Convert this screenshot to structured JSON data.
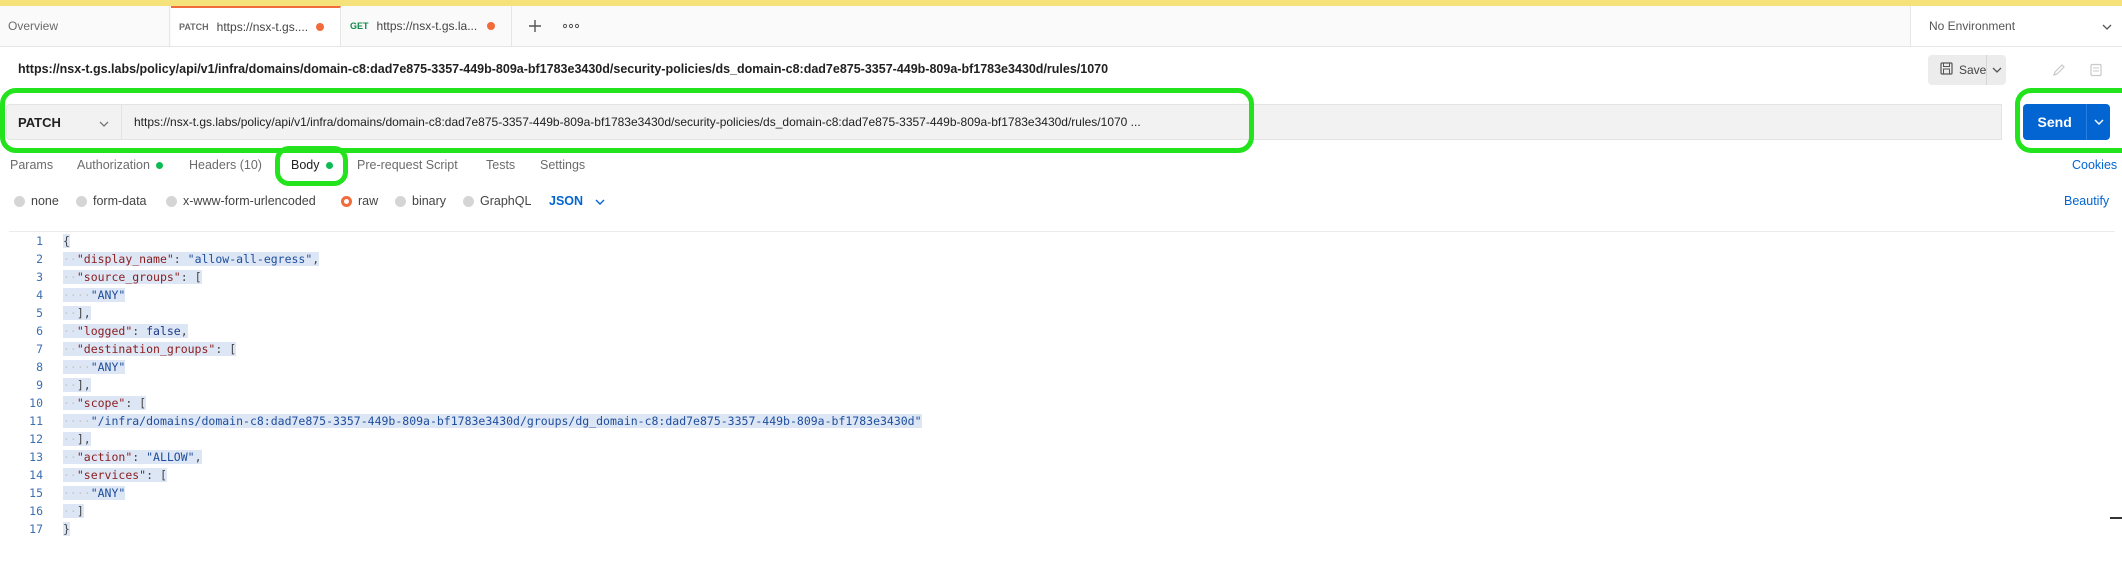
{
  "tabs": {
    "overview": "Overview",
    "items": [
      {
        "method": "PATCH",
        "title": "https://nsx-t.gs...."
      },
      {
        "method": "GET",
        "title": "https://nsx-t.gs.la..."
      }
    ],
    "environment": "No Environment"
  },
  "request": {
    "title": "https://nsx-t.gs.labs/policy/api/v1/infra/domains/domain-c8:dad7e875-3357-449b-809a-bf1783e3430d/security-policies/ds_domain-c8:dad7e875-3357-449b-809a-bf1783e3430d/rules/1070",
    "save_label": "Save",
    "method": "PATCH",
    "url": "https://nsx-t.gs.labs/policy/api/v1/infra/domains/domain-c8:dad7e875-3357-449b-809a-bf1783e3430d/security-policies/ds_domain-c8:dad7e875-3357-449b-809a-bf1783e3430d/rules/1070 ...",
    "send_label": "Send"
  },
  "request_tabs": {
    "params": "Params",
    "authorization": "Authorization",
    "headers": "Headers (10)",
    "body": "Body",
    "prerequest": "Pre-request Script",
    "tests": "Tests",
    "settings": "Settings",
    "cookies": "Cookies"
  },
  "body_options": {
    "none": "none",
    "form_data": "form-data",
    "urlencoded": "x-www-form-urlencoded",
    "raw": "raw",
    "binary": "binary",
    "graphql": "GraphQL",
    "format": "JSON",
    "beautify": "Beautify"
  },
  "editor": {
    "line_numbers": [
      "1",
      "2",
      "3",
      "4",
      "5",
      "6",
      "7",
      "8",
      "9",
      "10",
      "11",
      "12",
      "13",
      "14",
      "15",
      "16",
      "17"
    ],
    "lines": [
      {
        "i": "",
        "parts": [
          {
            "t": "p",
            "v": "{"
          }
        ]
      },
      {
        "i": "··",
        "parts": [
          {
            "t": "k",
            "v": "\"display_name\""
          },
          {
            "t": "p",
            "v": ": "
          },
          {
            "t": "s",
            "v": "\"allow-all-egress\""
          },
          {
            "t": "p",
            "v": ","
          }
        ]
      },
      {
        "i": "··",
        "parts": [
          {
            "t": "k",
            "v": "\"source_groups\""
          },
          {
            "t": "p",
            "v": ": ["
          }
        ]
      },
      {
        "i": "····",
        "parts": [
          {
            "t": "s",
            "v": "\"ANY\""
          }
        ]
      },
      {
        "i": "··",
        "parts": [
          {
            "t": "p",
            "v": "],"
          }
        ]
      },
      {
        "i": "··",
        "parts": [
          {
            "t": "k",
            "v": "\"logged\""
          },
          {
            "t": "p",
            "v": ": "
          },
          {
            "t": "b",
            "v": "false"
          },
          {
            "t": "p",
            "v": ","
          }
        ]
      },
      {
        "i": "··",
        "parts": [
          {
            "t": "k",
            "v": "\"destination_groups\""
          },
          {
            "t": "p",
            "v": ": ["
          }
        ]
      },
      {
        "i": "····",
        "parts": [
          {
            "t": "s",
            "v": "\"ANY\""
          }
        ]
      },
      {
        "i": "··",
        "parts": [
          {
            "t": "p",
            "v": "],"
          }
        ]
      },
      {
        "i": "··",
        "parts": [
          {
            "t": "k",
            "v": "\"scope\""
          },
          {
            "t": "p",
            "v": ": ["
          }
        ]
      },
      {
        "i": "····",
        "parts": [
          {
            "t": "s",
            "v": "\"/infra/domains/domain-c8:dad7e875-3357-449b-809a-bf1783e3430d/groups/dg_domain-c8:dad7e875-3357-449b-809a-bf1783e3430d\""
          }
        ]
      },
      {
        "i": "··",
        "parts": [
          {
            "t": "p",
            "v": "],"
          }
        ]
      },
      {
        "i": "··",
        "parts": [
          {
            "t": "k",
            "v": "\"action\""
          },
          {
            "t": "p",
            "v": ": "
          },
          {
            "t": "s",
            "v": "\"ALLOW\""
          },
          {
            "t": "p",
            "v": ","
          }
        ]
      },
      {
        "i": "··",
        "parts": [
          {
            "t": "k",
            "v": "\"services\""
          },
          {
            "t": "p",
            "v": ": ["
          }
        ]
      },
      {
        "i": "····",
        "parts": [
          {
            "t": "s",
            "v": "\"ANY\""
          }
        ]
      },
      {
        "i": "··",
        "parts": [
          {
            "t": "p",
            "v": "]"
          }
        ]
      },
      {
        "i": "",
        "parts": [
          {
            "t": "p",
            "v": "}"
          }
        ]
      }
    ]
  },
  "colors": {
    "accent": "#0265d2",
    "highlight": "#22e31c",
    "active_tab": "#f26b3a",
    "status_dot": "#0cbb52"
  }
}
